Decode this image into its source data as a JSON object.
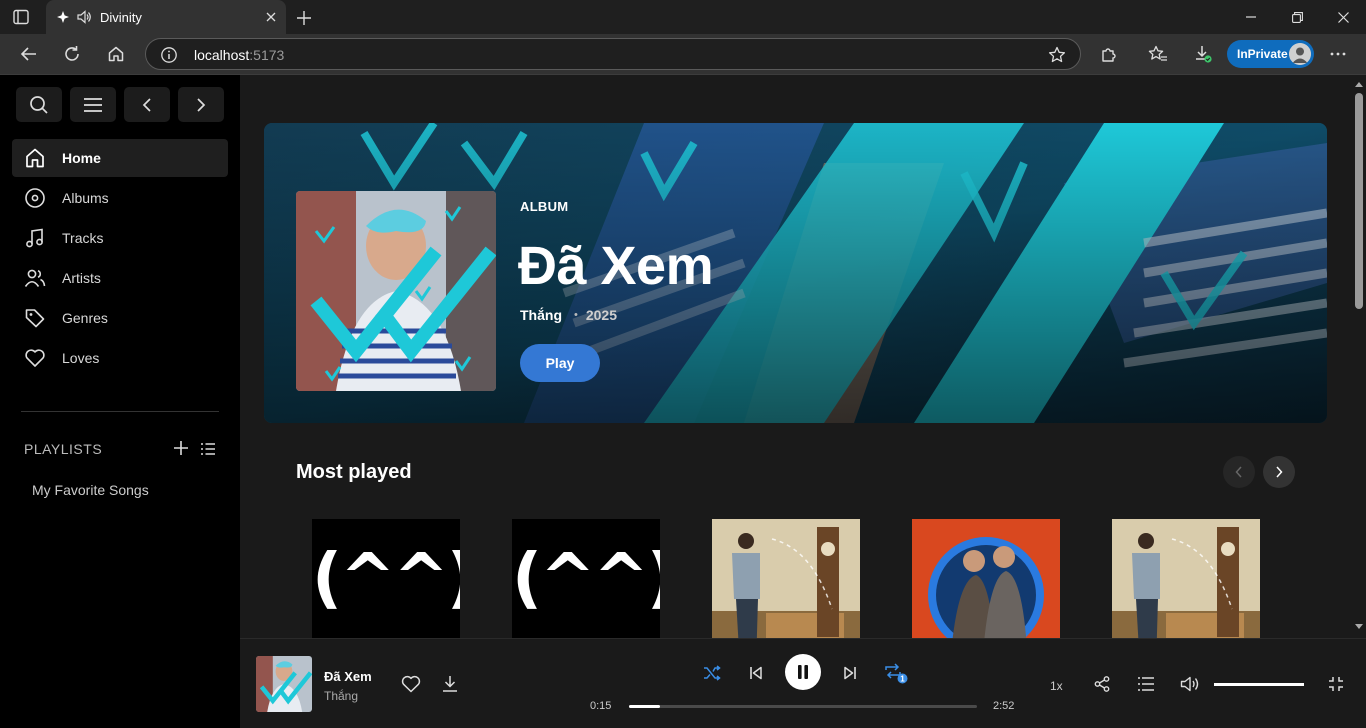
{
  "browser": {
    "tab_title": "Divinity",
    "url_host": "localhost",
    "url_port": ":5173",
    "inprivate_label": "InPrivate"
  },
  "sidebar": {
    "nav": [
      {
        "label": "Home",
        "icon": "home-icon",
        "active": true
      },
      {
        "label": "Albums",
        "icon": "disc-icon"
      },
      {
        "label": "Tracks",
        "icon": "music-note-icon"
      },
      {
        "label": "Artists",
        "icon": "people-icon"
      },
      {
        "label": "Genres",
        "icon": "tag-icon"
      },
      {
        "label": "Loves",
        "icon": "heart-icon"
      }
    ],
    "playlists_header": "PLAYLISTS",
    "playlists": [
      "My Favorite Songs"
    ]
  },
  "hero": {
    "type": "ALBUM",
    "title": "Đã Xem",
    "artist": "Thắng",
    "separator": "•",
    "year": "2025",
    "play_label": "Play"
  },
  "most_played": {
    "title": "Most played",
    "cards": [
      {
        "art": "kaomoji",
        "text": "(^^)"
      },
      {
        "art": "kaomoji",
        "text": "(^^)"
      },
      {
        "art": "photo-clock"
      },
      {
        "art": "photo-duo-red"
      },
      {
        "art": "photo-clock"
      }
    ]
  },
  "player": {
    "title": "Đã Xem",
    "artist": "Thắng",
    "current_time": "0:15",
    "total_time": "2:52",
    "progress": 0.09,
    "speed": "1x",
    "repeat_badge": "1",
    "volume": 1.0
  },
  "colors": {
    "accent": "#3478d4",
    "hero_cyan": "#1ec8d8",
    "shuffle_active": "#3a8ee6"
  }
}
